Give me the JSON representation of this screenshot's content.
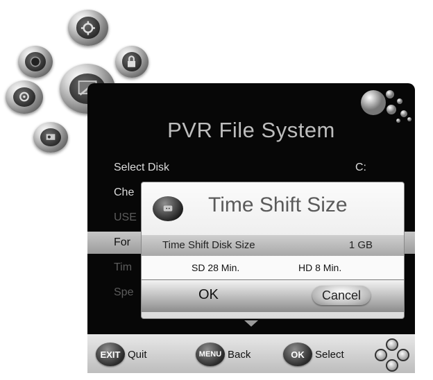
{
  "panel": {
    "title": "PVR File System",
    "menu": [
      {
        "label": "Select Disk",
        "value": "C:"
      },
      {
        "label": "Che",
        "value": ""
      },
      {
        "label": "USE",
        "value": ""
      },
      {
        "label": "For",
        "value": ""
      },
      {
        "label": "Tim",
        "value": ""
      },
      {
        "label": "Spe",
        "value": ""
      }
    ]
  },
  "dialog": {
    "title": "Time Shift Size",
    "setting_label": "Time Shift Disk Size",
    "setting_value": "1 GB",
    "sd_info": "SD 28 Min.",
    "hd_info": "HD 8 Min.",
    "ok_label": "OK",
    "cancel_label": "Cancel"
  },
  "bottombar": {
    "exit_key": "EXIT",
    "exit_label": "Quit",
    "menu_key": "MENU",
    "menu_label": "Back",
    "ok_key": "OK",
    "ok_label": "Select"
  },
  "icons": {
    "orbs": [
      "globe-icon",
      "settings-icon",
      "lock-icon",
      "picture-icon",
      "media-icon",
      "tools-icon"
    ],
    "dialog": "tv-icon",
    "down": "down-arrow-icon",
    "dpad": "navigation-pad-icon"
  }
}
